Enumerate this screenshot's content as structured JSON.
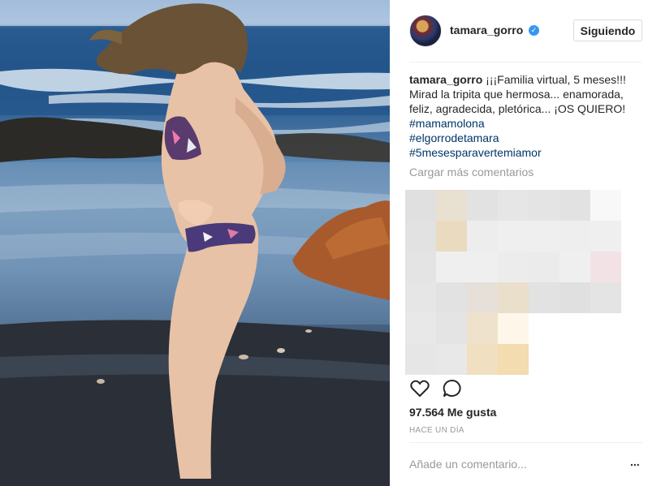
{
  "post": {
    "username": "tamara_gorro",
    "follow_label": "Siguiendo",
    "caption_user": "tamara_gorro",
    "caption_text": "¡¡¡Familia virtual, 5 meses!!! Mirad la tripita que hermosa... enamorada, feliz, agradecida, pletórica... ¡OS QUIERO!",
    "hashtags": [
      "#mamamolona",
      "#elgorrodetamara",
      "#5mesesparavertemiamor"
    ],
    "load_more_label": "Cargar más comentarios",
    "likes_label": "97.564 Me gusta",
    "date_label": "HACE UN DÍA",
    "comment_placeholder": "Añade un comentario...",
    "more_options": "..."
  },
  "icons": {
    "verified": "verified-badge-icon",
    "like": "heart-icon",
    "comment": "speech-bubble-icon",
    "more": "ellipsis-icon"
  },
  "colors": {
    "hashtag": "#003569",
    "muted": "#999999",
    "verified": "#3897f0",
    "text": "#262626"
  }
}
